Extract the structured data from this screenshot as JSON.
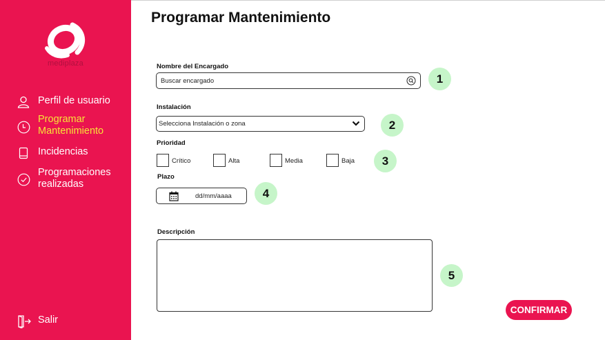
{
  "sidebar": {
    "logo_text": "mediplaza",
    "items": [
      {
        "label": "Perfil de usuario",
        "icon": "user-icon",
        "active": false
      },
      {
        "label": "Programar\nMantenimiento",
        "icon": "clock-icon",
        "active": true
      },
      {
        "label": "Incidencias",
        "icon": "book-icon",
        "active": false
      },
      {
        "label": "Programaciones\nrealizadas",
        "icon": "check-circle-icon",
        "active": false
      }
    ],
    "logout_label": "Salir"
  },
  "main": {
    "title": "Programar Mantenimiento",
    "encargado": {
      "label": "Nombre del Encargado",
      "placeholder": "Buscar encargado"
    },
    "instalacion": {
      "label": "Instalación",
      "selected": "Selecciona Instalación o zona"
    },
    "prioridad": {
      "label": "Prioridad",
      "options": [
        "Crítico",
        "Alta",
        "Media",
        "Baja"
      ]
    },
    "plazo": {
      "label": "Plazo",
      "placeholder": "dd/mm/aaaa"
    },
    "descripcion": {
      "label": "Descripción",
      "value": ""
    },
    "confirm_label": "CONFIRMAR"
  },
  "step_badges": [
    "1",
    "2",
    "3",
    "4",
    "5"
  ],
  "colors": {
    "brand": "#ea1450",
    "active_nav": "#f7e437",
    "badge": "#c6f5c9"
  }
}
